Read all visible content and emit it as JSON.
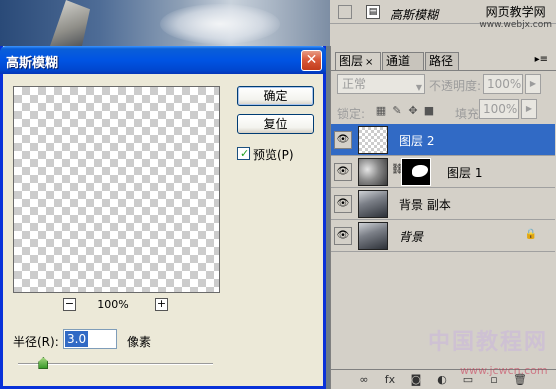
{
  "dialog": {
    "title": "高斯模糊",
    "close_glyph": "✕",
    "ok_label": "确定",
    "reset_label": "复位",
    "preview_checkbox_label": "预览(P)",
    "preview_checked": true,
    "zoom_minus": "−",
    "zoom_plus": "+",
    "zoom_value": "100%",
    "radius_label": "半径(R):",
    "radius_value": "3.0",
    "radius_unit": "像素",
    "radius_slider_fraction": 0.13
  },
  "history": {
    "item_label": "高斯模糊",
    "icon": "document-icon"
  },
  "watermark": {
    "line1": "网页教学网",
    "line2": "www.webjx.com",
    "bottom_big": "中国教程网",
    "bottom_url": "www.jcwcn.com"
  },
  "layers_panel": {
    "tabs": [
      {
        "label": "图层",
        "close": "×",
        "active": true
      },
      {
        "label": "通道",
        "active": false
      },
      {
        "label": "路径",
        "active": false
      }
    ],
    "menu_glyph": "▸≡",
    "blend_mode": "正常",
    "opacity_label": "不透明度:",
    "opacity_value": "100%",
    "lock_label": "锁定:",
    "fill_label": "填充:",
    "fill_value": "100%",
    "layers": [
      {
        "name": "图层 2",
        "selected": true,
        "thumb": "transparent"
      },
      {
        "name": "图层 1",
        "selected": false,
        "thumb": "clouds",
        "has_mask": true
      },
      {
        "name": "背景 副本",
        "selected": false,
        "thumb": "photo"
      },
      {
        "name": "背景",
        "selected": false,
        "thumb": "photo",
        "italic": true,
        "locked": true
      }
    ],
    "bottom_icons": [
      "link-icon",
      "fx-icon",
      "mask-icon",
      "adjustment-icon",
      "group-icon",
      "new-layer-icon",
      "trash-icon"
    ]
  },
  "colors": {
    "title_bar": "#0054e3",
    "selection": "#316ac5",
    "dialog_bg": "#ece9d8",
    "panel_bg": "#d4d0c8"
  }
}
